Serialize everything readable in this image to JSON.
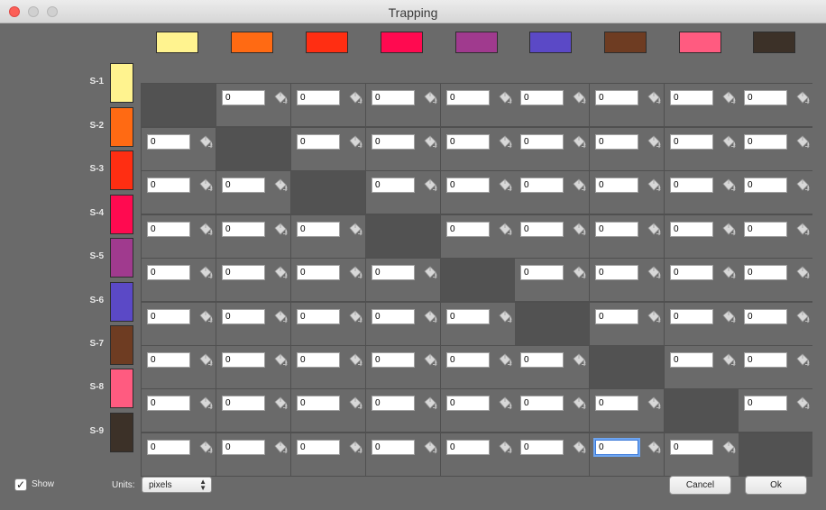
{
  "window": {
    "title": "Trapping"
  },
  "colors": [
    "#fff38f",
    "#ff6a13",
    "#ff2e12",
    "#ff0a50",
    "#a03a8e",
    "#5b49c6",
    "#6e3c22",
    "#ff5b80",
    "#3c3128"
  ],
  "rows": [
    {
      "label": "S-1",
      "values": [
        null,
        "0",
        "0",
        "0",
        "0",
        "0",
        "0",
        "0",
        "0"
      ]
    },
    {
      "label": "S-2",
      "values": [
        "0",
        null,
        "0",
        "0",
        "0",
        "0",
        "0",
        "0",
        "0"
      ]
    },
    {
      "label": "S-3",
      "values": [
        "0",
        "0",
        null,
        "0",
        "0",
        "0",
        "0",
        "0",
        "0"
      ]
    },
    {
      "label": "S-4",
      "values": [
        "0",
        "0",
        "0",
        null,
        "0",
        "0",
        "0",
        "0",
        "0"
      ]
    },
    {
      "label": "S-5",
      "values": [
        "0",
        "0",
        "0",
        "0",
        null,
        "0",
        "0",
        "0",
        "0"
      ]
    },
    {
      "label": "S-6",
      "values": [
        "0",
        "0",
        "0",
        "0",
        "0",
        null,
        "0",
        "0",
        "0"
      ]
    },
    {
      "label": "S-7",
      "values": [
        "0",
        "0",
        "0",
        "0",
        "0",
        "0",
        null,
        "0",
        "0"
      ]
    },
    {
      "label": "S-8",
      "values": [
        "0",
        "0",
        "0",
        "0",
        "0",
        "0",
        "0",
        null,
        "0"
      ]
    },
    {
      "label": "S-9",
      "values": [
        "0",
        "0",
        "0",
        "0",
        "0",
        "0",
        "0",
        "0",
        null
      ]
    }
  ],
  "focused_cell": {
    "row": 8,
    "col": 6
  },
  "icons": {
    "cell_action": "paint-bucket-icon"
  },
  "footer": {
    "show_label": "Show",
    "show_checked": true,
    "units_label": "Units:",
    "units_value": "pixels",
    "cancel_label": "Cancel",
    "ok_label": "Ok"
  }
}
